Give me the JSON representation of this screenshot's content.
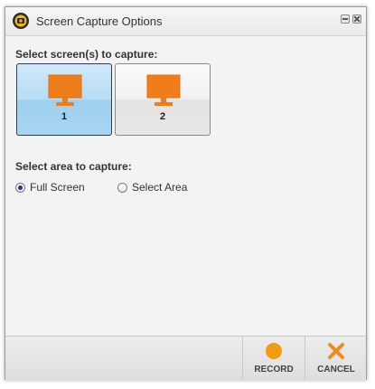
{
  "window": {
    "title": "Screen Capture Options",
    "icon": "screen-capture-app-icon"
  },
  "screens": {
    "label": "Select screen(s) to capture:",
    "items": [
      {
        "number": "1",
        "selected": true,
        "icon": "monitor-icon"
      },
      {
        "number": "2",
        "selected": false,
        "icon": "monitor-icon"
      }
    ]
  },
  "area": {
    "label": "Select area to capture:",
    "options": [
      {
        "label": "Full Screen",
        "checked": true
      },
      {
        "label": "Select Area",
        "checked": false
      }
    ]
  },
  "footer": {
    "record_label": "RECORD",
    "cancel_label": "CANCEL"
  },
  "colors": {
    "accent_orange": "#f39c12",
    "selected_tile": "#b7dcf4"
  }
}
